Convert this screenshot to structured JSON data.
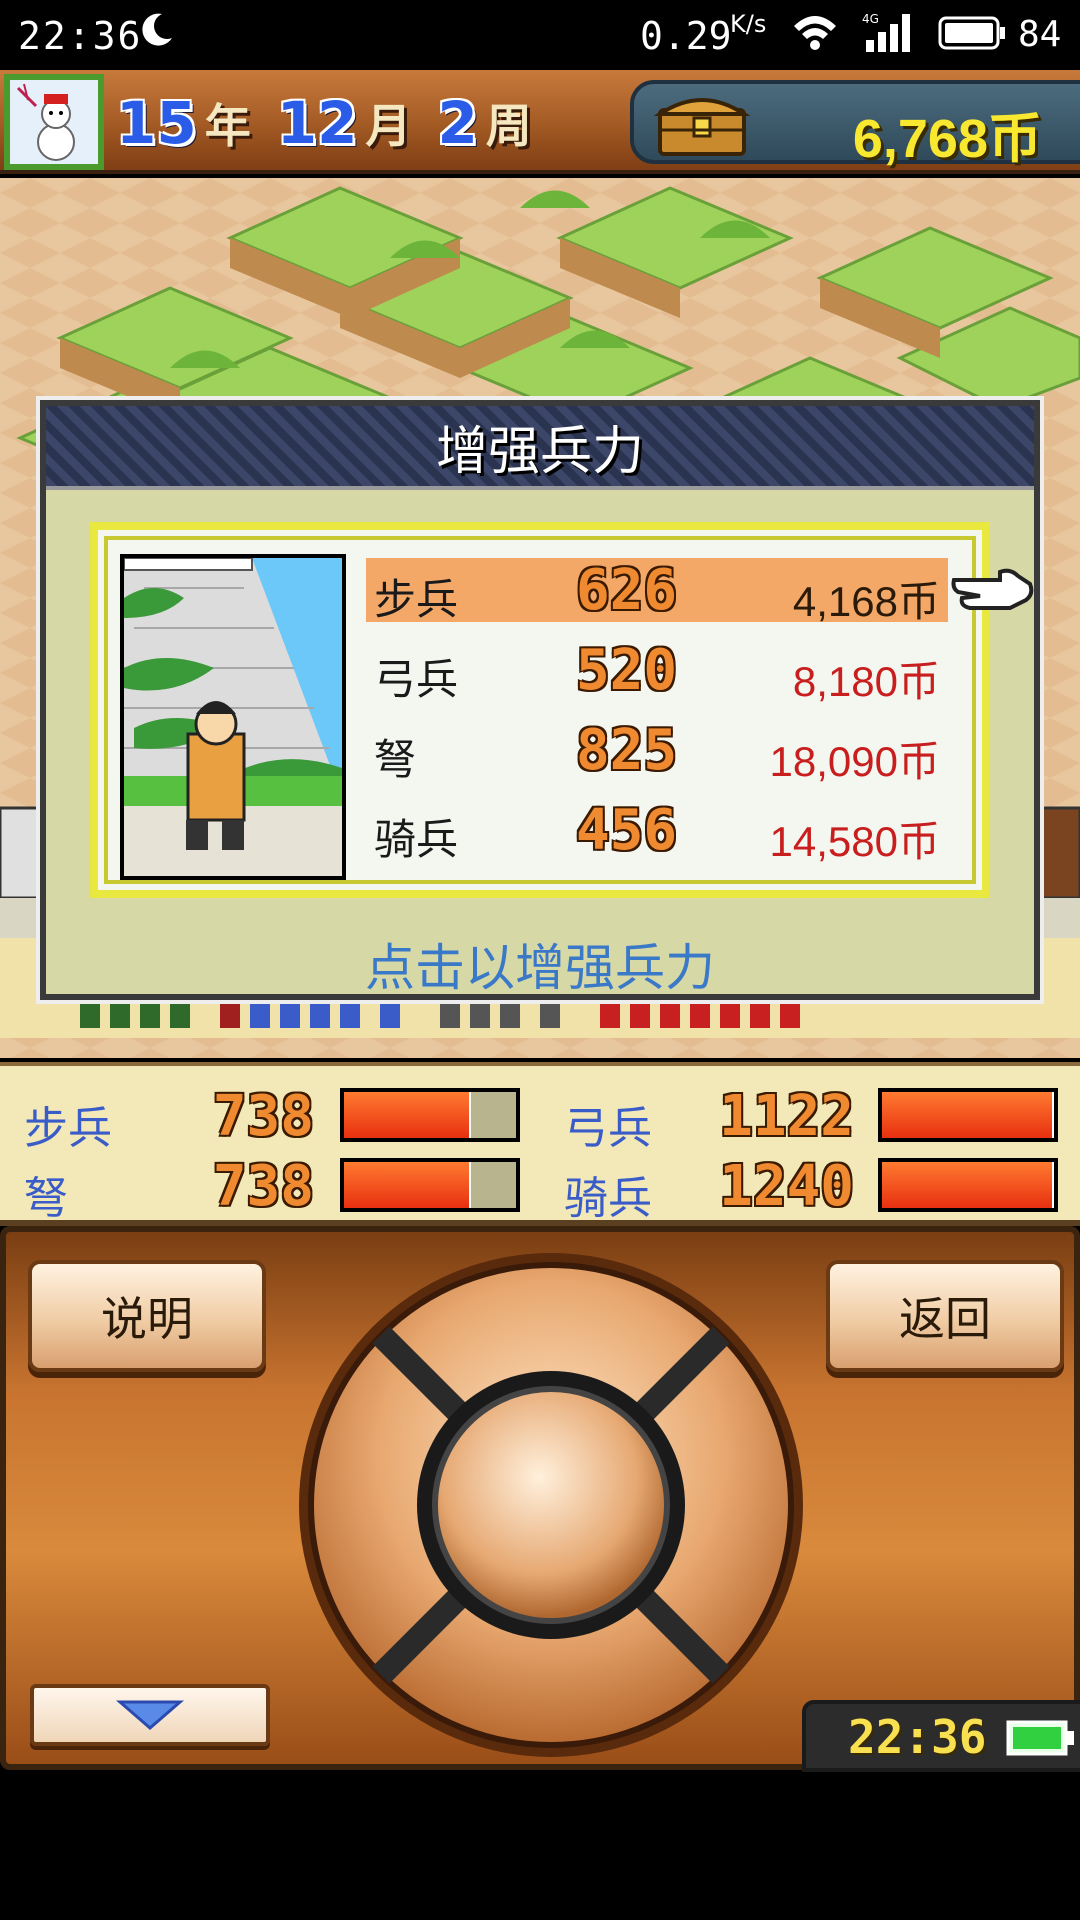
{
  "status_bar": {
    "time": "22:36",
    "net_speed": "0.29",
    "net_unit": "K/s",
    "signal_type": "4G",
    "battery_level": "84"
  },
  "top_bar": {
    "year": "15",
    "year_unit": "年",
    "month": "12",
    "month_unit": "月",
    "week": "2",
    "week_unit": "周",
    "coins": "6,768币"
  },
  "dialog": {
    "title": "增强兵力",
    "hint": "点击以增强兵力",
    "units": [
      {
        "name": "步兵",
        "count": "626",
        "cost": "4,168币"
      },
      {
        "name": "弓兵",
        "count": "520",
        "cost": "8,180币"
      },
      {
        "name": "弩",
        "count": "825",
        "cost": "18,090币"
      },
      {
        "name": "骑兵",
        "count": "456",
        "cost": "14,580币"
      }
    ]
  },
  "army_stats": [
    {
      "name": "步兵",
      "value": "738",
      "level": 0.74
    },
    {
      "name": "弓兵",
      "value": "1122",
      "level": 1.0
    },
    {
      "name": "弩",
      "value": "738",
      "level": 0.74
    },
    {
      "name": "骑兵",
      "value": "1240",
      "level": 1.0
    }
  ],
  "controls": {
    "help_label": "说明",
    "back_label": "返回",
    "clock": "22:36"
  },
  "colors": {
    "stat_label": "#3a5cc8",
    "cost_red": "#c81e1e",
    "selected_row": "#f4a868",
    "hint_blue": "#3a78c8"
  }
}
